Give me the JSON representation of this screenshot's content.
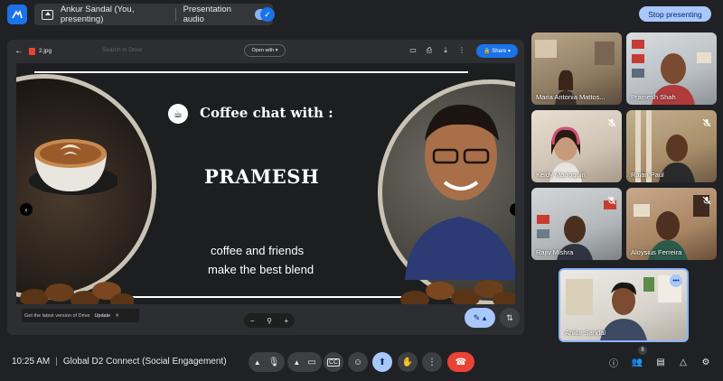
{
  "topbar": {
    "presenter_label": "Ankur Sandal (You, presenting)",
    "audio_label": "Presentation audio",
    "stop_button": "Stop presenting"
  },
  "drive": {
    "file_name": "2.jpg",
    "search_placeholder": "Search in Drive",
    "open_with": "Open with",
    "share": "Share",
    "update_notice": "Get the latest version of Drive",
    "update_link": "Update"
  },
  "slide": {
    "title": "Coffee chat with :",
    "name": "PRAMESH",
    "tagline_1": "coffee and friends",
    "tagline_2": "make the best blend"
  },
  "participants": [
    {
      "name": "Maria Antonia Mattos...",
      "muted": false
    },
    {
      "name": "Pramesh Shah",
      "muted": false
    },
    {
      "name": "Keidy Marroquin",
      "muted": true
    },
    {
      "name": "Rajan Paul",
      "muted": true
    },
    {
      "name": "Rajiv Mishra",
      "muted": true
    },
    {
      "name": "Aloysius Ferreira",
      "muted": true
    },
    {
      "name": "Ankur Sandal",
      "muted": false
    }
  ],
  "bottom": {
    "time": "10:25 AM",
    "meeting_name": "Global D2 Connect (Social Engagement)",
    "people_count": "8"
  },
  "colors": {
    "background": "#202124",
    "accent": "#a8c7fa",
    "end_call": "#ea4335",
    "brand_blue": "#1a73e8"
  },
  "icons": [
    "meet-logo-icon",
    "present-screen-icon",
    "check-icon",
    "mic-icon",
    "camera-icon",
    "captions-icon",
    "emoji-icon",
    "present-icon",
    "raise-hand-icon",
    "more-icon",
    "end-call-icon",
    "info-icon",
    "people-icon",
    "chat-icon",
    "activities-icon",
    "host-controls-icon"
  ]
}
